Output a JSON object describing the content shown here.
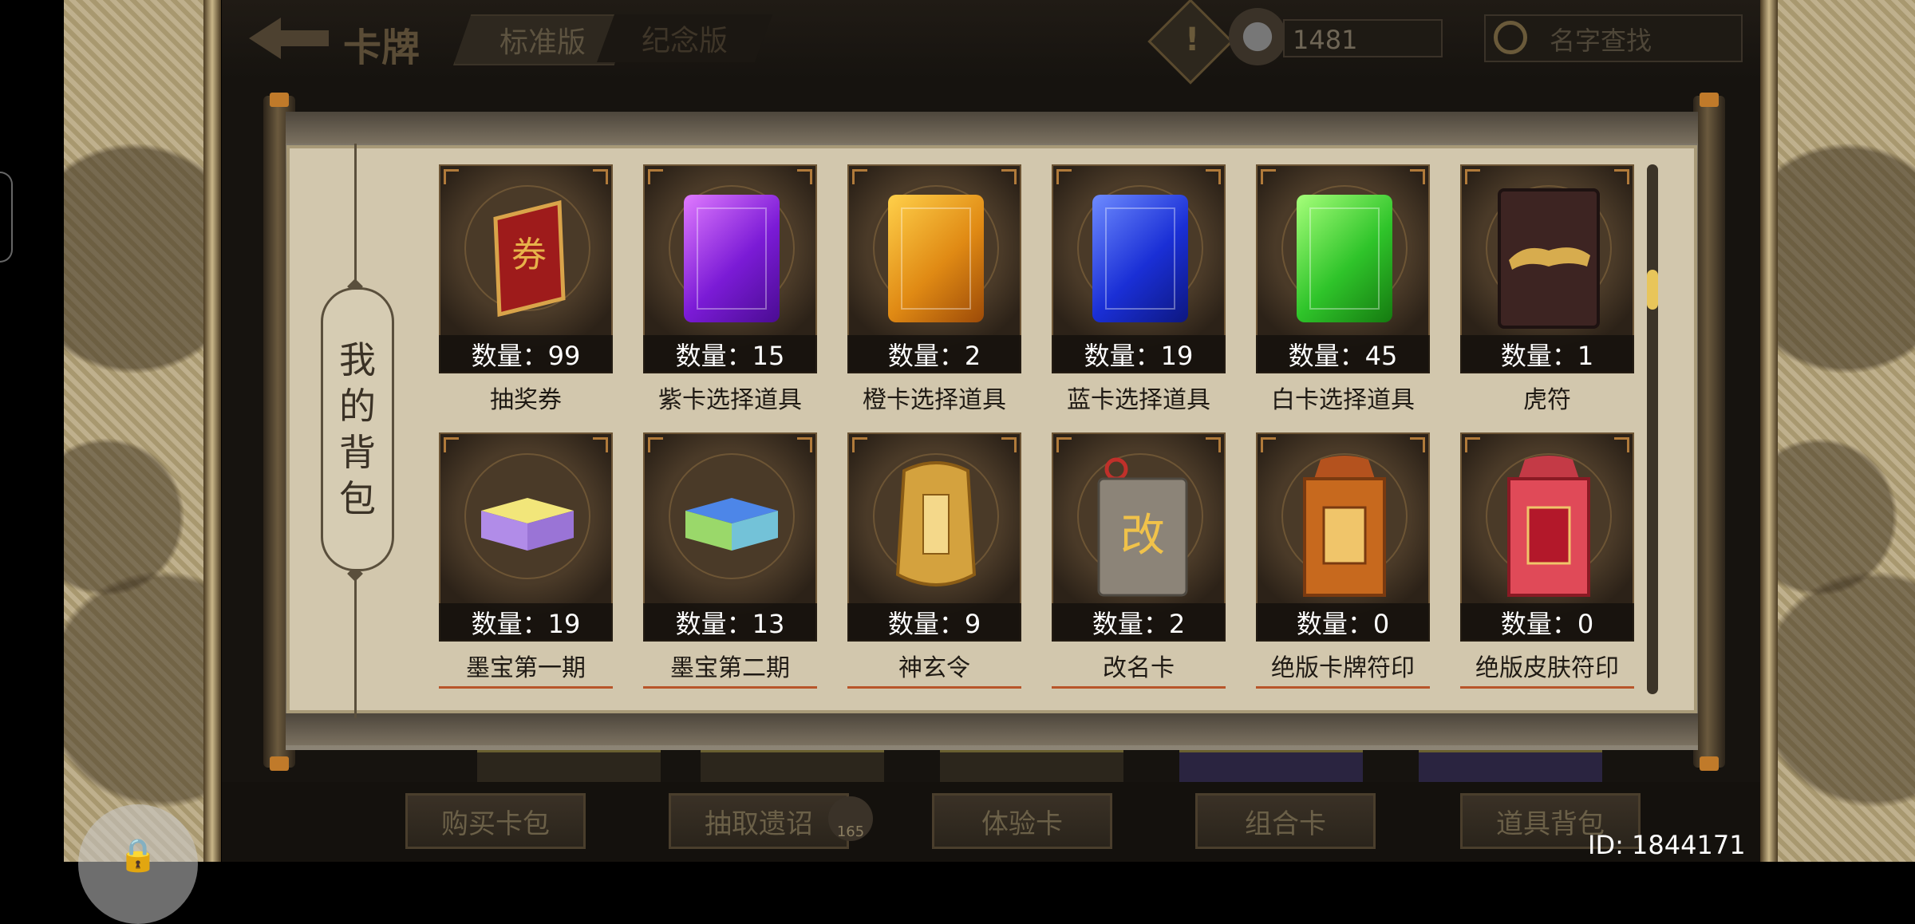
{
  "header": {
    "title": "卡牌",
    "tabs": [
      {
        "label": "标准版",
        "active": true
      },
      {
        "label": "纪念版",
        "active": false
      }
    ],
    "currency_amount": "1481",
    "search_placeholder": "名字查找"
  },
  "panel": {
    "label_chars": [
      "我",
      "的",
      "背",
      "包"
    ]
  },
  "items": [
    {
      "count_label": "数量：99",
      "name": "抽奖券",
      "icon": "lottery-ticket-icon"
    },
    {
      "count_label": "数量：15",
      "name": "紫卡选择道具",
      "icon": "purple-card-icon"
    },
    {
      "count_label": "数量：2",
      "name": "橙卡选择道具",
      "icon": "orange-card-icon"
    },
    {
      "count_label": "数量：19",
      "name": "蓝卡选择道具",
      "icon": "blue-card-icon"
    },
    {
      "count_label": "数量：45",
      "name": "白卡选择道具",
      "icon": "green-card-icon"
    },
    {
      "count_label": "数量：1",
      "name": "虎符",
      "icon": "tiger-tally-icon"
    },
    {
      "count_label": "数量：19",
      "name": "墨宝第一期",
      "icon": "gift-box-purple-icon"
    },
    {
      "count_label": "数量：13",
      "name": "墨宝第二期",
      "icon": "gift-box-blue-icon"
    },
    {
      "count_label": "数量：9",
      "name": "神玄令",
      "icon": "gold-token-icon"
    },
    {
      "count_label": "数量：2",
      "name": "改名卡",
      "icon": "rename-card-icon"
    },
    {
      "count_label": "数量：0",
      "name": "绝版卡牌符印",
      "icon": "orange-seal-pack-icon"
    },
    {
      "count_label": "数量：0",
      "name": "绝版皮肤符印",
      "icon": "red-seal-pack-icon"
    }
  ],
  "bottom_buttons": [
    "购买卡包",
    "抽取遗诏",
    "体验卡",
    "组合卡",
    "道具背包"
  ],
  "badge_count": "165",
  "user_id": "ID: 1844171",
  "colors": {
    "accent_gold": "#e8c55a",
    "scroll_paper": "#d2c7ad",
    "card_border": "#6d5535"
  }
}
